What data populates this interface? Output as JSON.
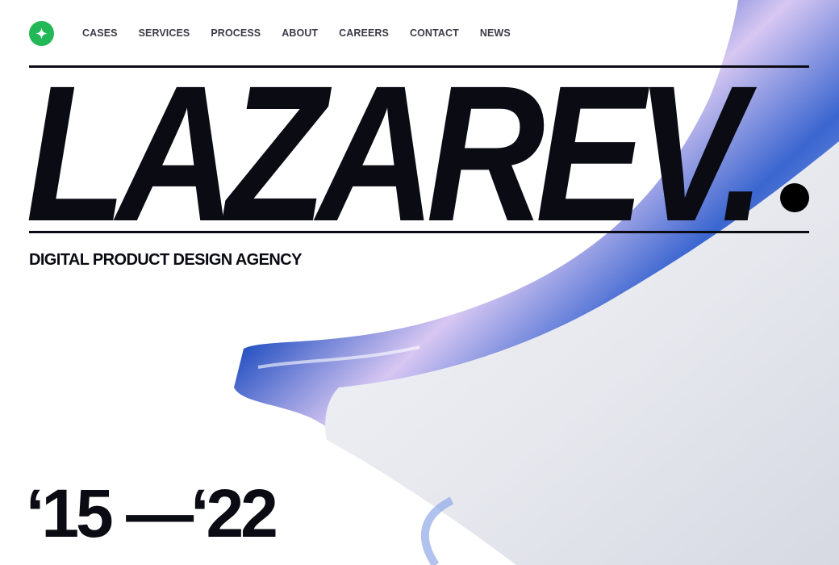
{
  "brand": {
    "name": "LAZAREV.",
    "tagline": "DIGITAL PRODUCT DESIGN AGENCY",
    "logo_icon": "sparkle-icon",
    "logo_color": "#22b757"
  },
  "nav": {
    "items": [
      "CASES",
      "SERVICES",
      "PROCESS",
      "ABOUT",
      "CAREERS",
      "CONTACT",
      "NEWS"
    ]
  },
  "hero": {
    "years": "‘15 —‘22",
    "art": "iridescent-glass-shape"
  },
  "colors": {
    "text": "#0b0b14",
    "background": "#ffffff",
    "accent": "#22b757"
  }
}
